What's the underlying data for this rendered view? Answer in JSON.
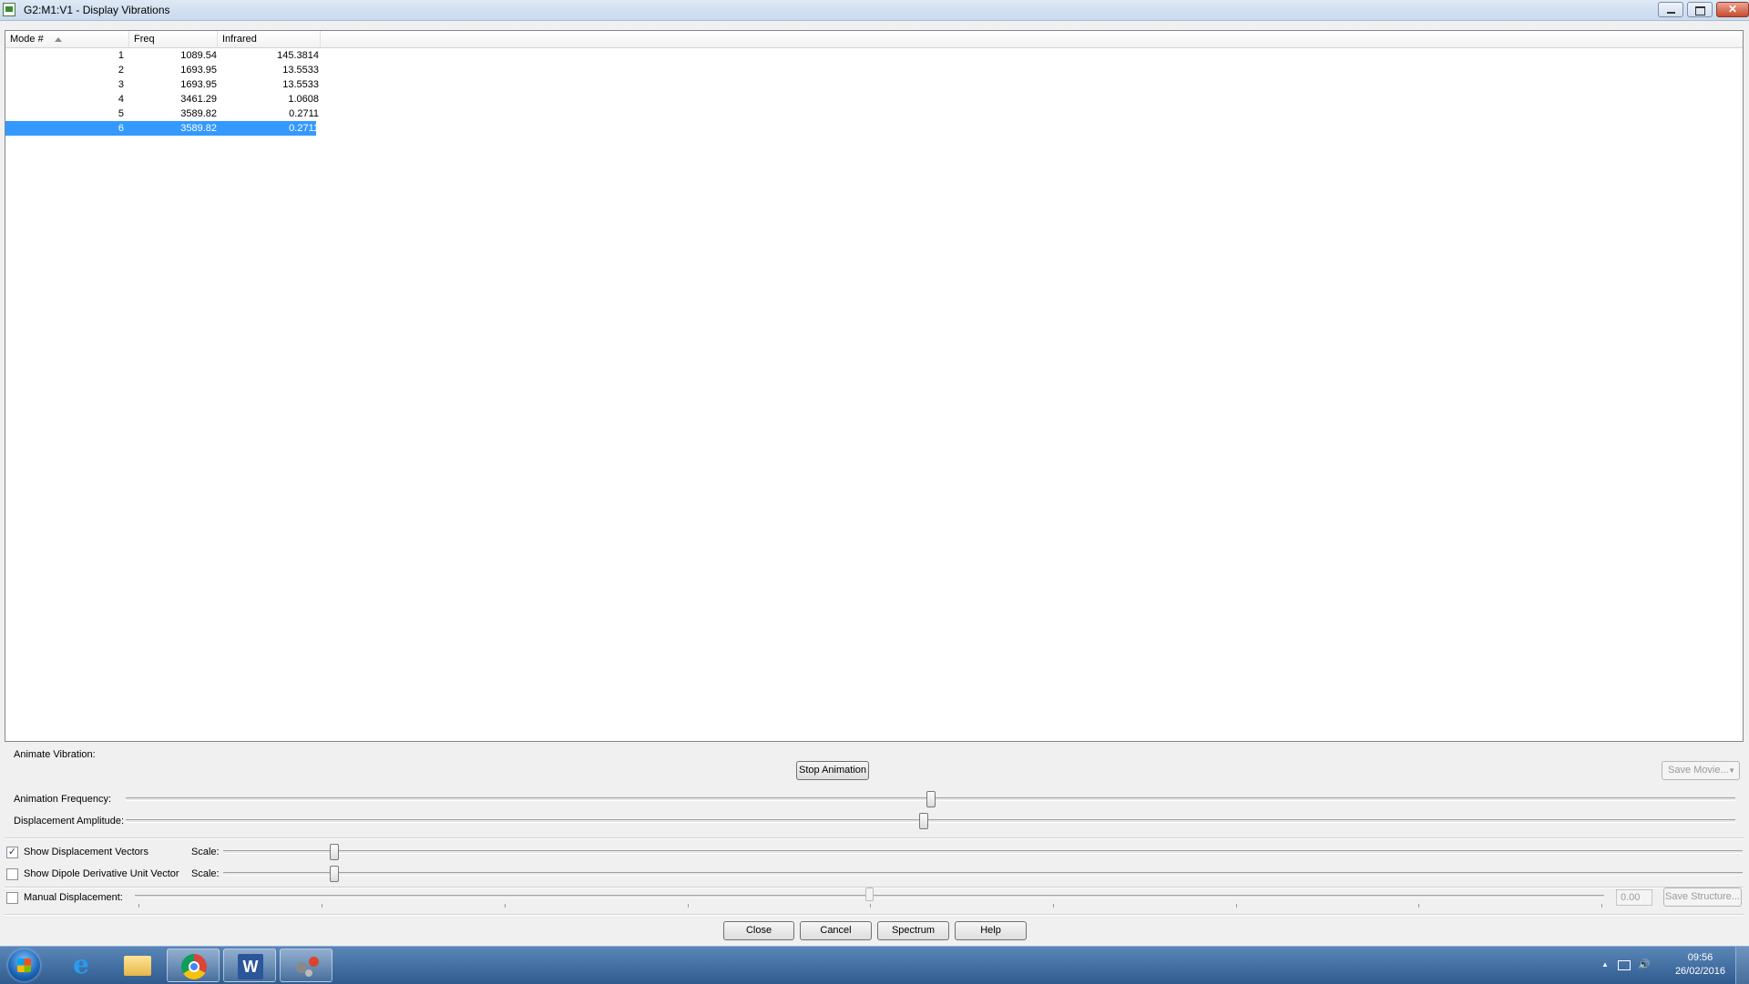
{
  "window": {
    "title": "G2:M1:V1 - Display Vibrations",
    "close_glyph": "✕"
  },
  "table": {
    "columns": [
      "Mode #",
      "Freq",
      "Infrared"
    ],
    "rows": [
      {
        "mode": "1",
        "freq": "1089.54",
        "infrared": "145.3814"
      },
      {
        "mode": "2",
        "freq": "1693.95",
        "infrared": "13.5533"
      },
      {
        "mode": "3",
        "freq": "1693.95",
        "infrared": "13.5533"
      },
      {
        "mode": "4",
        "freq": "3461.29",
        "infrared": "1.0608"
      },
      {
        "mode": "5",
        "freq": "3589.82",
        "infrared": "0.2711"
      },
      {
        "mode": "6",
        "freq": "3589.82",
        "infrared": "0.2711"
      }
    ],
    "selected_row": 6,
    "sort_column": "Mode #",
    "sort_direction": "ascending"
  },
  "animate": {
    "section_label": "Animate Vibration:",
    "stop_button": "Stop Animation",
    "save_movie_button": "Save Movie...",
    "frequency_label": "Animation Frequency:",
    "frequency_value": 0.5,
    "amplitude_label": "Displacement Amplitude:",
    "amplitude_value": 0.5
  },
  "vectors": {
    "show_displacement_label": "Show Displacement Vectors",
    "show_displacement_checked": true,
    "show_dipole_label": "Show Dipole Derivative Unit Vector",
    "show_dipole_checked": false,
    "scale_label": "Scale:",
    "displacement_scale_value": 0.06,
    "dipole_scale_value": 0.06
  },
  "manual": {
    "label": "Manual Displacement:",
    "checked": false,
    "slider_value": 0.5,
    "value_text": "0.00",
    "save_structure_button": "Save Structure..."
  },
  "buttons": {
    "close": "Close",
    "cancel": "Cancel",
    "spectrum": "Spectrum",
    "help": "Help"
  },
  "taskbar": {
    "apps": [
      "start-orb",
      "internet-explorer",
      "file-explorer",
      "chrome",
      "word",
      "gaussview"
    ],
    "time": "09:56",
    "date": "26/02/2016",
    "tray_up_glyph": "▲",
    "speaker_glyph": "🔊"
  },
  "colors": {
    "selection": "#3399ff",
    "taskbar": "#2f5b8f"
  }
}
